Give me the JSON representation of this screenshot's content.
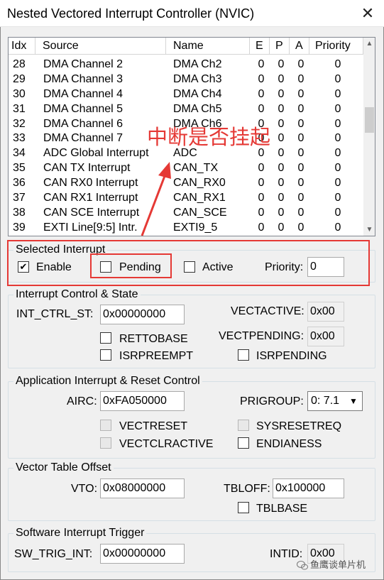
{
  "window": {
    "title": "Nested Vectored Interrupt Controller (NVIC)",
    "close_glyph": "✕"
  },
  "list": {
    "columns": [
      "Idx",
      "Source",
      "Name",
      "E",
      "P",
      "A",
      "Priority"
    ],
    "rows": [
      {
        "idx": "28",
        "source": "DMA Channel 2",
        "name": "DMA Ch2",
        "e": "0",
        "p": "0",
        "a": "0",
        "priority": "0"
      },
      {
        "idx": "29",
        "source": "DMA Channel 3",
        "name": "DMA Ch3",
        "e": "0",
        "p": "0",
        "a": "0",
        "priority": "0"
      },
      {
        "idx": "30",
        "source": "DMA Channel 4",
        "name": "DMA Ch4",
        "e": "0",
        "p": "0",
        "a": "0",
        "priority": "0"
      },
      {
        "idx": "31",
        "source": "DMA Channel 5",
        "name": "DMA Ch5",
        "e": "0",
        "p": "0",
        "a": "0",
        "priority": "0"
      },
      {
        "idx": "32",
        "source": "DMA Channel 6",
        "name": "DMA Ch6",
        "e": "0",
        "p": "0",
        "a": "0",
        "priority": "0"
      },
      {
        "idx": "33",
        "source": "DMA Channel 7",
        "name": "",
        "e": "0",
        "p": "0",
        "a": "0",
        "priority": "0"
      },
      {
        "idx": "34",
        "source": "ADC Global Interrupt",
        "name": "ADC",
        "e": "0",
        "p": "0",
        "a": "0",
        "priority": "0"
      },
      {
        "idx": "35",
        "source": "CAN TX  Interrupt",
        "name": "CAN_TX",
        "e": "0",
        "p": "0",
        "a": "0",
        "priority": "0"
      },
      {
        "idx": "36",
        "source": "CAN RX0 Interrupt",
        "name": "CAN_RX0",
        "e": "0",
        "p": "0",
        "a": "0",
        "priority": "0"
      },
      {
        "idx": "37",
        "source": "CAN RX1 Interrupt",
        "name": "CAN_RX1",
        "e": "0",
        "p": "0",
        "a": "0",
        "priority": "0"
      },
      {
        "idx": "38",
        "source": "CAN SCE Interrupt",
        "name": "CAN_SCE",
        "e": "0",
        "p": "0",
        "a": "0",
        "priority": "0"
      },
      {
        "idx": "39",
        "source": "EXTI Line[9:5] Intr.",
        "name": "EXTI9_5",
        "e": "0",
        "p": "0",
        "a": "0",
        "priority": "0"
      }
    ],
    "scroll_up_glyph": "▲",
    "scroll_down_glyph": "▼"
  },
  "selected_interrupt": {
    "title": "Selected Interrupt",
    "enable_label": "Enable",
    "enable_checked": true,
    "pending_label": "Pending",
    "active_label": "Active",
    "priority_label": "Priority:",
    "priority_value": "0"
  },
  "int_control": {
    "title": "Interrupt Control & State",
    "int_ctrl_st_label": "INT_CTRL_ST:",
    "int_ctrl_st_value": "0x00000000",
    "vectactive_label": "VECTACTIVE:",
    "vectactive_value": "0x00",
    "vectpending_label": "VECTPENDING:",
    "vectpending_value": "0x00",
    "rettobase_label": "RETTOBASE",
    "isrpreempt_label": "ISRPREEMPT",
    "isrpending_label": "ISRPENDING"
  },
  "airc": {
    "title": "Application Interrupt & Reset Control",
    "airc_label": "AIRC:",
    "airc_value": "0xFA050000",
    "prigroup_label": "PRIGROUP:",
    "prigroup_value": "0: 7.1",
    "vectreset_label": "VECTRESET",
    "vectclractive_label": "VECTCLRACTIVE",
    "sysresetreq_label": "SYSRESETREQ",
    "endianess_label": "ENDIANESS"
  },
  "vto": {
    "title": "Vector Table Offset",
    "vto_label": "VTO:",
    "vto_value": "0x08000000",
    "tbloff_label": "TBLOFF:",
    "tbloff_value": "0x100000",
    "tblbase_label": "TBLBASE"
  },
  "swtrig": {
    "title": "Software Interrupt Trigger",
    "sw_trig_label": "SW_TRIG_INT:",
    "sw_trig_value": "0x00000000",
    "intid_label": "INTID:",
    "intid_value": "0x00"
  },
  "annotation": {
    "text": "中断是否挂起",
    "color": "#e53935"
  },
  "watermark": {
    "text": "鱼鹰谈单片机"
  },
  "check_glyph": "✔"
}
